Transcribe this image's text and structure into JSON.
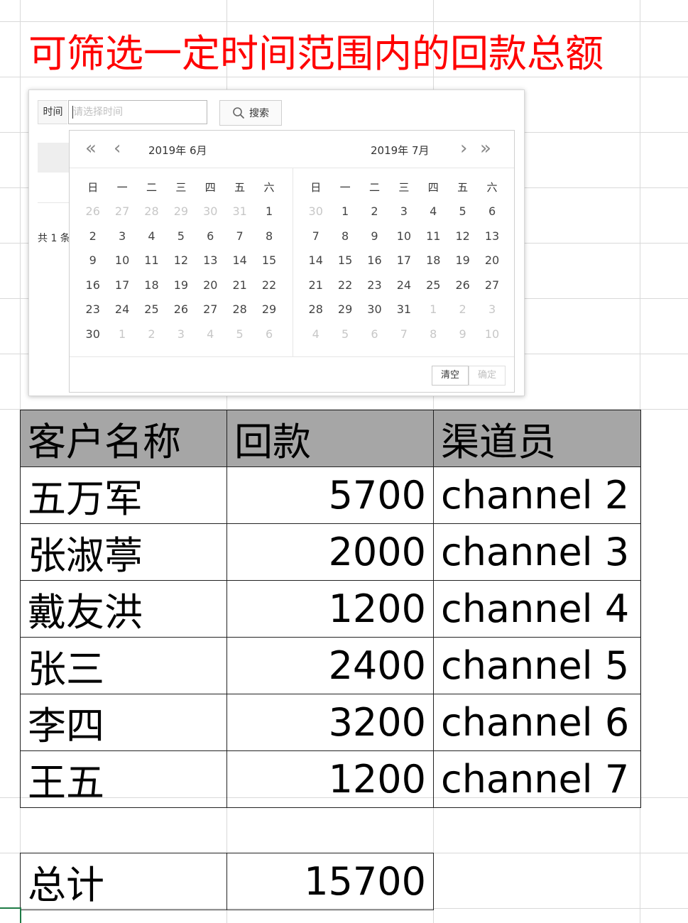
{
  "heading": "可筛选一定时间范围内的回款总额",
  "filter": {
    "time_label": "时间",
    "time_placeholder": "请选择时间",
    "search_label": "搜索",
    "total_count": "共 1 条"
  },
  "calendar": {
    "weekdays": [
      "日",
      "一",
      "二",
      "三",
      "四",
      "五",
      "六"
    ],
    "left": {
      "title": "2019年  6月",
      "days": [
        {
          "d": "26",
          "muted": true
        },
        {
          "d": "27",
          "muted": true
        },
        {
          "d": "28",
          "muted": true
        },
        {
          "d": "29",
          "muted": true
        },
        {
          "d": "30",
          "muted": true
        },
        {
          "d": "31",
          "muted": true
        },
        {
          "d": "1"
        },
        {
          "d": "2"
        },
        {
          "d": "3"
        },
        {
          "d": "4"
        },
        {
          "d": "5"
        },
        {
          "d": "6"
        },
        {
          "d": "7"
        },
        {
          "d": "8"
        },
        {
          "d": "9"
        },
        {
          "d": "10"
        },
        {
          "d": "11"
        },
        {
          "d": "12"
        },
        {
          "d": "13"
        },
        {
          "d": "14"
        },
        {
          "d": "15"
        },
        {
          "d": "16"
        },
        {
          "d": "17"
        },
        {
          "d": "18"
        },
        {
          "d": "19"
        },
        {
          "d": "20"
        },
        {
          "d": "21"
        },
        {
          "d": "22"
        },
        {
          "d": "23"
        },
        {
          "d": "24"
        },
        {
          "d": "25"
        },
        {
          "d": "26"
        },
        {
          "d": "27"
        },
        {
          "d": "28"
        },
        {
          "d": "29"
        },
        {
          "d": "30"
        },
        {
          "d": "1",
          "muted": true
        },
        {
          "d": "2",
          "muted": true
        },
        {
          "d": "3",
          "muted": true
        },
        {
          "d": "4",
          "muted": true
        },
        {
          "d": "5",
          "muted": true
        },
        {
          "d": "6",
          "muted": true
        }
      ]
    },
    "right": {
      "title": "2019年  7月",
      "days": [
        {
          "d": "30",
          "muted": true
        },
        {
          "d": "1"
        },
        {
          "d": "2"
        },
        {
          "d": "3"
        },
        {
          "d": "4"
        },
        {
          "d": "5"
        },
        {
          "d": "6"
        },
        {
          "d": "7"
        },
        {
          "d": "8"
        },
        {
          "d": "9"
        },
        {
          "d": "10"
        },
        {
          "d": "11"
        },
        {
          "d": "12"
        },
        {
          "d": "13"
        },
        {
          "d": "14"
        },
        {
          "d": "15"
        },
        {
          "d": "16"
        },
        {
          "d": "17"
        },
        {
          "d": "18"
        },
        {
          "d": "19"
        },
        {
          "d": "20"
        },
        {
          "d": "21"
        },
        {
          "d": "22"
        },
        {
          "d": "23"
        },
        {
          "d": "24"
        },
        {
          "d": "25"
        },
        {
          "d": "26"
        },
        {
          "d": "27"
        },
        {
          "d": "28"
        },
        {
          "d": "29"
        },
        {
          "d": "30"
        },
        {
          "d": "31"
        },
        {
          "d": "1",
          "muted": true
        },
        {
          "d": "2",
          "muted": true
        },
        {
          "d": "3",
          "muted": true
        },
        {
          "d": "4",
          "muted": true
        },
        {
          "d": "5",
          "muted": true
        },
        {
          "d": "6",
          "muted": true
        },
        {
          "d": "7",
          "muted": true
        },
        {
          "d": "8",
          "muted": true
        },
        {
          "d": "9",
          "muted": true
        },
        {
          "d": "10",
          "muted": true
        }
      ]
    },
    "clear_label": "清空",
    "ok_label": "确定"
  },
  "table": {
    "headers": [
      "客户名称",
      "回款",
      "渠道员"
    ],
    "rows": [
      [
        "五万军",
        "5700",
        "channel 2"
      ],
      [
        "张淑葶",
        "2000",
        "channel 3"
      ],
      [
        "戴友洪",
        "1200",
        "channel 4"
      ],
      [
        "张三",
        "2400",
        "channel 5"
      ],
      [
        "李四",
        "3200",
        "channel 6"
      ],
      [
        "王五",
        "1200",
        "channel 7"
      ]
    ]
  },
  "total": {
    "label": "总计",
    "value": "15700"
  },
  "colors": {
    "heading": "#ff0000",
    "header_fill": "#a6a6a6",
    "grid": "#d9d9d9"
  }
}
